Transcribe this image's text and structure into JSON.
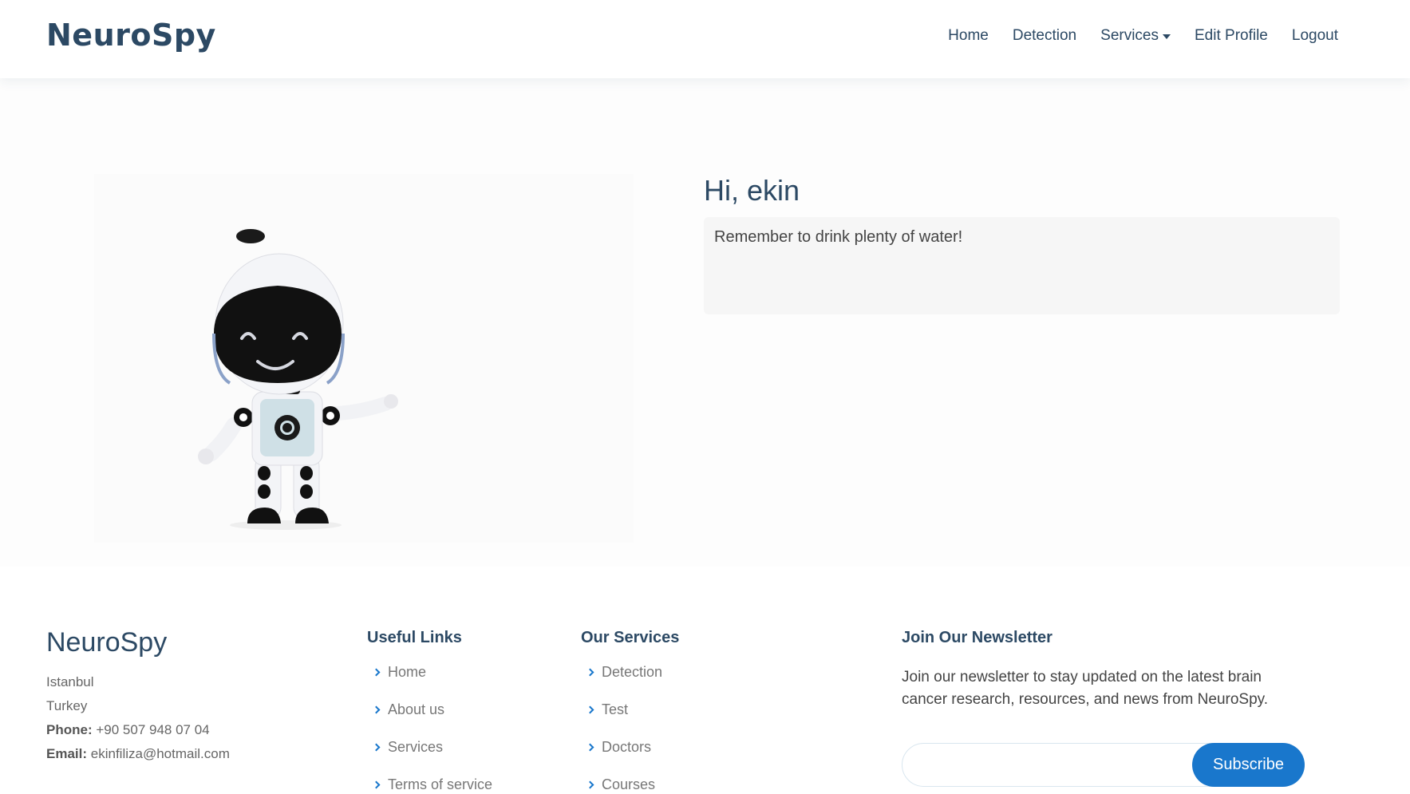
{
  "header": {
    "logo": "NeuroSpy",
    "nav": [
      {
        "label": "Home"
      },
      {
        "label": "Detection"
      },
      {
        "label": "Services"
      },
      {
        "label": "Edit Profile"
      },
      {
        "label": "Logout"
      }
    ]
  },
  "main": {
    "greeting": "Hi, ekin",
    "message": "Remember to drink plenty of water!",
    "illustration_icon": "robot-mascot-icon"
  },
  "footer": {
    "brand": "NeuroSpy",
    "city": "Istanbul",
    "country": "Turkey",
    "phone_label": "Phone:",
    "phone": "+90 507 948 07 04",
    "email_label": "Email:",
    "email": "ekinfiliza@hotmail.com",
    "useful_links": {
      "title": "Useful Links",
      "items": [
        "Home",
        "About us",
        "Services",
        "Terms of service"
      ]
    },
    "our_services": {
      "title": "Our Services",
      "items": [
        "Detection",
        "Test",
        "Doctors",
        "Courses"
      ]
    },
    "newsletter": {
      "title": "Join Our Newsletter",
      "text": "Join our newsletter to stay updated on the latest brain cancer research, resources, and news from NeuroSpy.",
      "input_value": "",
      "button": "Subscribe"
    }
  },
  "colors": {
    "brand": "#2c4964",
    "accent": "#1977cc"
  }
}
